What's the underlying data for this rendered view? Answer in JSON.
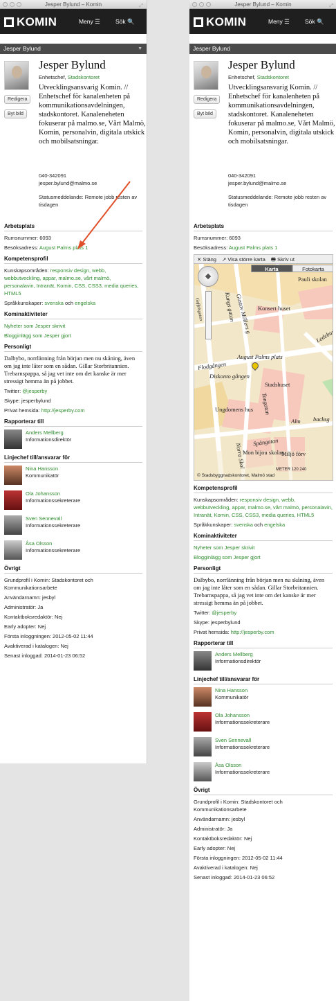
{
  "window_title": "Jesper Bylund – Komin",
  "app": {
    "logo": "KOMIN",
    "menu": "Meny ☰",
    "search": "Sök 🔍"
  },
  "subheader": "Jesper Bylund",
  "profile": {
    "name": "Jesper Bylund",
    "title_prefix": "Enhetschef, ",
    "title_link": "Stadskontoret",
    "edit_button": "Redigera",
    "change_photo_button": "Byt bild",
    "description": "Utvecklingsansvarig Komin. // Enhetschef för kanalenheten på kommunikationsavdelningen, stadskontoret. Kanaleneheten fokuserar på malmo.se, Vårt Malmö, Komin, personalvin, digitala utskick och mobilsatsningar.",
    "phone": "040-342091",
    "email": "jesper.bylund@malmo.se",
    "status": "Statusmeddelande: Remote jobb resten av tisdagen"
  },
  "workplace": {
    "heading": "Arbetsplats",
    "room": "Rumsnummer: 6093",
    "address_label": "Besöksadress: ",
    "address_link": "August Palms plats 1"
  },
  "map": {
    "close": "✕ Stäng",
    "bigger": "↗ Visa större karta",
    "print": "🖶 Skriv ut",
    "tab_map": "Karta",
    "tab_photo": "Fotokarta",
    "labels": [
      "Pauli skolan",
      "Gustav Möllers g",
      "Konsert huset",
      "Flodgången",
      "August Palms plats",
      "Diskonto gången",
      "Stadshuset",
      "Ungdomens hus",
      "Tongatan",
      "Alm",
      "backsg",
      "Spångatan",
      "Mon bijou skolan",
      "Miljö förv",
      "Ledebur",
      "Kungs gatan",
      "Norra Skol",
      "Gaffelsgatan"
    ],
    "scale": "METER",
    "scale_n1": "120",
    "scale_n2": "240",
    "copyright": "© Stadsbyggnadskontoret, Malmö stad"
  },
  "competence": {
    "heading": "Kompetensprofil",
    "areas_label": "Kunskapsområden: ",
    "areas": "responsiv design, webb, webbutveckling, appar, malmo.se, vårt malmö, personalavin, Intranät, Komin, CSS, CSS3, media queries, HTML5",
    "lang_label": "Språkkunskaper: ",
    "lang1": "svenska",
    "lang_and": " och ",
    "lang2": "engelska"
  },
  "kominact": {
    "heading": "Kominaktiviteter",
    "news": "Nyheter som Jesper skrivit",
    "blogs": "Blogginlägg som Jesper gjort"
  },
  "personal": {
    "heading": "Personligt",
    "bio": "Dalbybo, norrlänning från början men nu skåning, även om jag inte låter som en sådan. Gillar Storbritannien. Trebarnspappa, så jag vet inte om det kanske är mer stressigt hemma än på jobbet.",
    "twitter_label": "Twitter: ",
    "twitter": "@jesperby",
    "skype": "Skype: jesperbylund",
    "home_label": "Privat hemsida: ",
    "home": "http://jesperby.com"
  },
  "reports": {
    "heading": "Rapporterar till",
    "people": [
      {
        "name": "Anders Mellberg",
        "role": "Informationsdirektör"
      }
    ]
  },
  "manages": {
    "heading": "Linjechef till/ansvarar för",
    "people": [
      {
        "name": "Nina Hansson",
        "role": "Kommunikatör"
      },
      {
        "name": "Ola Johansson",
        "role": "Informationssekreterare"
      },
      {
        "name": "Sven Sennevall",
        "role": "Informationssekreterare"
      },
      {
        "name": "Åsa Olsson",
        "role": "Informationssekreterare"
      }
    ]
  },
  "other": {
    "heading": "Övrigt",
    "lines": [
      "Grundprofil i Komin: Stadskontoret och Kommunikationsarbete",
      "Användarnamn: jesbyl",
      "Administratör: Ja",
      "Kontaktboksredaktör: Nej",
      "Early adopter: Nej",
      "Första inloggningen: 2012-05-02 11:44",
      "Avaktiverad i katalogen: Nej",
      "Senast inloggad: 2014-01-23 06:52"
    ]
  },
  "colors": {
    "link": "#2e8b2e",
    "nav": "#1f1f1f",
    "annotation_arrow": "#e0502a"
  }
}
